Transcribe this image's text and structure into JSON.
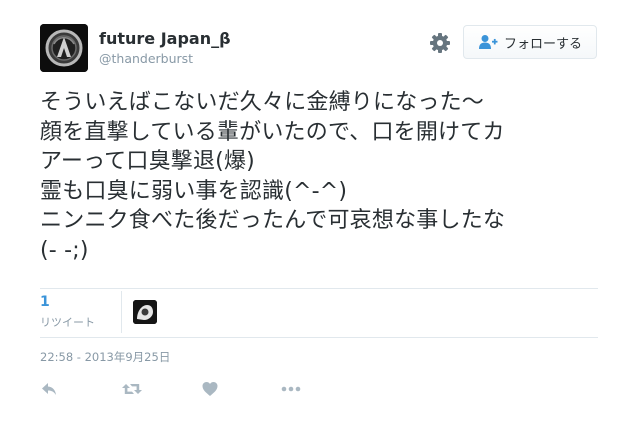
{
  "user": {
    "display_name": "future Japan_β",
    "handle": "@thanderburst"
  },
  "follow_button": {
    "label": "フォローする"
  },
  "tweet": {
    "lines": [
      "そういえばこないだ久々に金縛りになった〜",
      "顔を直撃している輩がいたので、口を開けてカ",
      "アーって口臭撃退(爆)",
      "霊も口臭に弱い事を認識(^-^)",
      "ニンニク食べた後だったんで可哀想な事したな",
      "(- -;)"
    ]
  },
  "stats": {
    "retweet_count": "1",
    "retweet_label": "リツイート"
  },
  "timestamp": "22:58 - 2013年9月25日",
  "icons": {
    "settings": "gear-icon",
    "follow": "person-add-icon",
    "reply": "reply-icon",
    "retweet": "retweet-icon",
    "like": "heart-icon",
    "more": "more-icon"
  },
  "colors": {
    "text": "#292f33",
    "muted": "#8899a6",
    "link_blue": "#3b94d9",
    "action_icon": "#aab8c2",
    "divider": "#e1e8ed"
  }
}
